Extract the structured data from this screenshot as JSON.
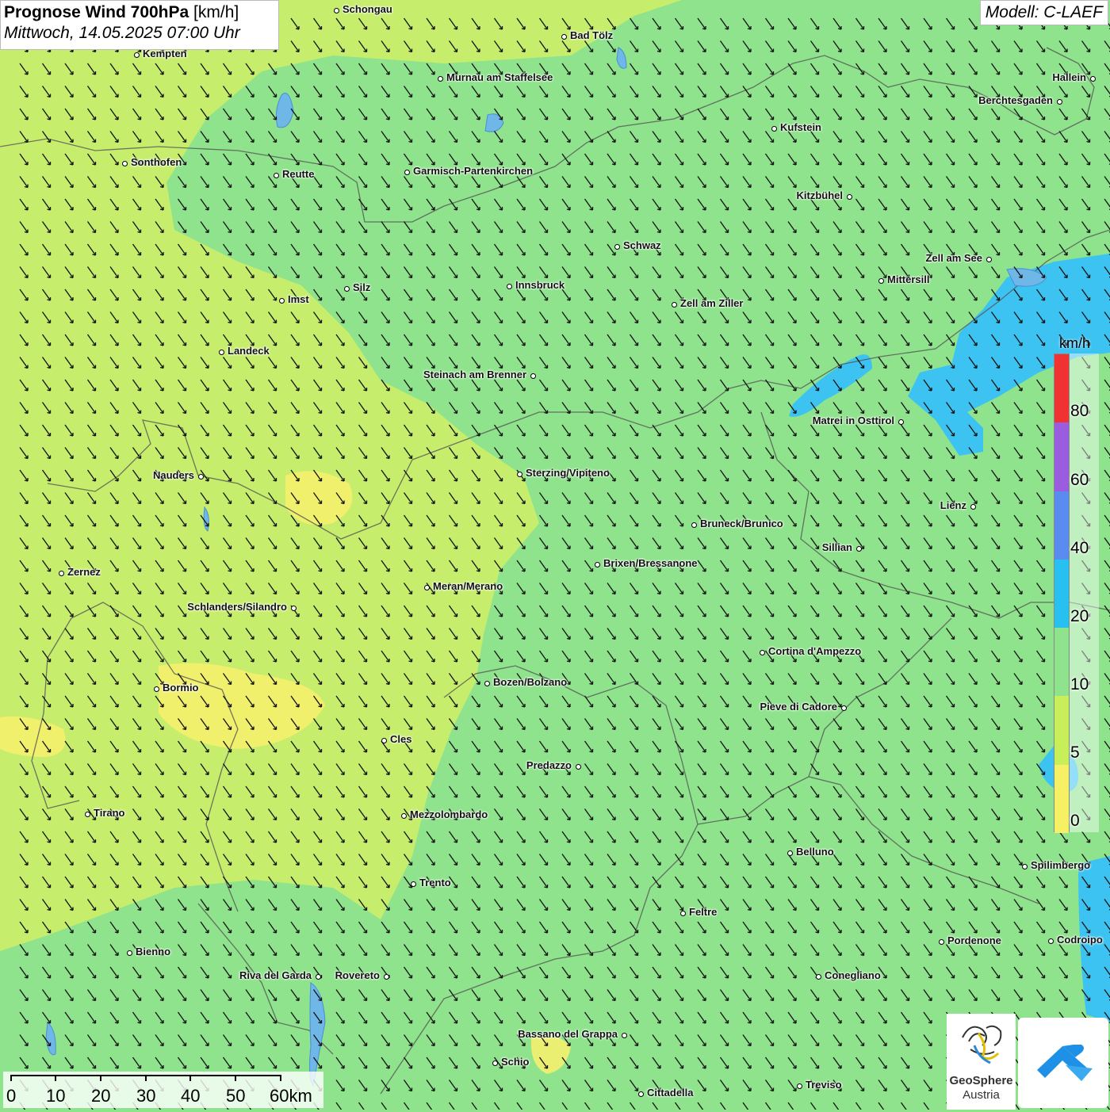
{
  "header": {
    "title_bold": "Prognose Wind 700hPa",
    "title_unit": "[km/h]",
    "datetime": "Mittwoch, 14.05.2025 07:00 Uhr"
  },
  "model_label": "Modell: C-LAEF",
  "legend": {
    "unit": "km/h",
    "ticks": [
      "80",
      "60",
      "40",
      "20",
      "10",
      "5",
      "0"
    ],
    "colors": [
      "#f5f5f5",
      "#f03232",
      "#9b5de0",
      "#5a8cf0",
      "#28c0f0",
      "#8ee38c",
      "#c8ee5a",
      "#f5f064"
    ]
  },
  "scale_bar": {
    "labels": [
      "0",
      "10",
      "20",
      "30",
      "40",
      "50",
      "60km"
    ]
  },
  "logos": {
    "geosphere_line1": "GeoSphere",
    "geosphere_line2": "Austria"
  },
  "wind_field": {
    "field_color": "#8ee38c",
    "zone_colors": {
      "light_green": "#c6ee6c",
      "yellow": "#f4ef6e",
      "blue": "#3cc3f2"
    },
    "arrow_direction": "north-west to south-east",
    "arrow_color": "#111111"
  },
  "cities": [
    {
      "name": "Schongau"
    },
    {
      "name": "Bad Tölz"
    },
    {
      "name": "Kempten"
    },
    {
      "name": "Murnau am Staffelsee"
    },
    {
      "name": "Hallein"
    },
    {
      "name": "Berchtesgaden"
    },
    {
      "name": "Kufstein"
    },
    {
      "name": "Sonthofen"
    },
    {
      "name": "Reutte"
    },
    {
      "name": "Garmisch-Partenkirchen"
    },
    {
      "name": "Kitzbühel"
    },
    {
      "name": "Schwaz"
    },
    {
      "name": "Zell am See"
    },
    {
      "name": "Mittersill"
    },
    {
      "name": "Innsbruck"
    },
    {
      "name": "Silz"
    },
    {
      "name": "Imst"
    },
    {
      "name": "Zell am Ziller"
    },
    {
      "name": "Landeck"
    },
    {
      "name": "Steinach am Brenner"
    },
    {
      "name": "Matrei in Osttirol"
    },
    {
      "name": "Nauders"
    },
    {
      "name": "Sterzing/Vipiteno"
    },
    {
      "name": "Lienz"
    },
    {
      "name": "Bruneck/Brunico"
    },
    {
      "name": "Sillian"
    },
    {
      "name": "Brixen/Bressanone"
    },
    {
      "name": "Zernez"
    },
    {
      "name": "Meran/Merano"
    },
    {
      "name": "Schlanders/Silandro"
    },
    {
      "name": "Cortina d'Ampezzo"
    },
    {
      "name": "Bozen/Bolzano"
    },
    {
      "name": "Bormio"
    },
    {
      "name": "Pieve di Cadore"
    },
    {
      "name": "Cles"
    },
    {
      "name": "Predazzo"
    },
    {
      "name": "Tirano"
    },
    {
      "name": "Mezzolombardo"
    },
    {
      "name": "Belluno"
    },
    {
      "name": "Spilimbergo"
    },
    {
      "name": "Trento"
    },
    {
      "name": "Feltre"
    },
    {
      "name": "Pordenone"
    },
    {
      "name": "Codroipo"
    },
    {
      "name": "Bienno"
    },
    {
      "name": "Riva del Garda"
    },
    {
      "name": "Rovereto"
    },
    {
      "name": "Conegliano"
    },
    {
      "name": "Bassano del Grappa"
    },
    {
      "name": "Schio"
    },
    {
      "name": "Treviso"
    },
    {
      "name": "Cittadella"
    }
  ]
}
